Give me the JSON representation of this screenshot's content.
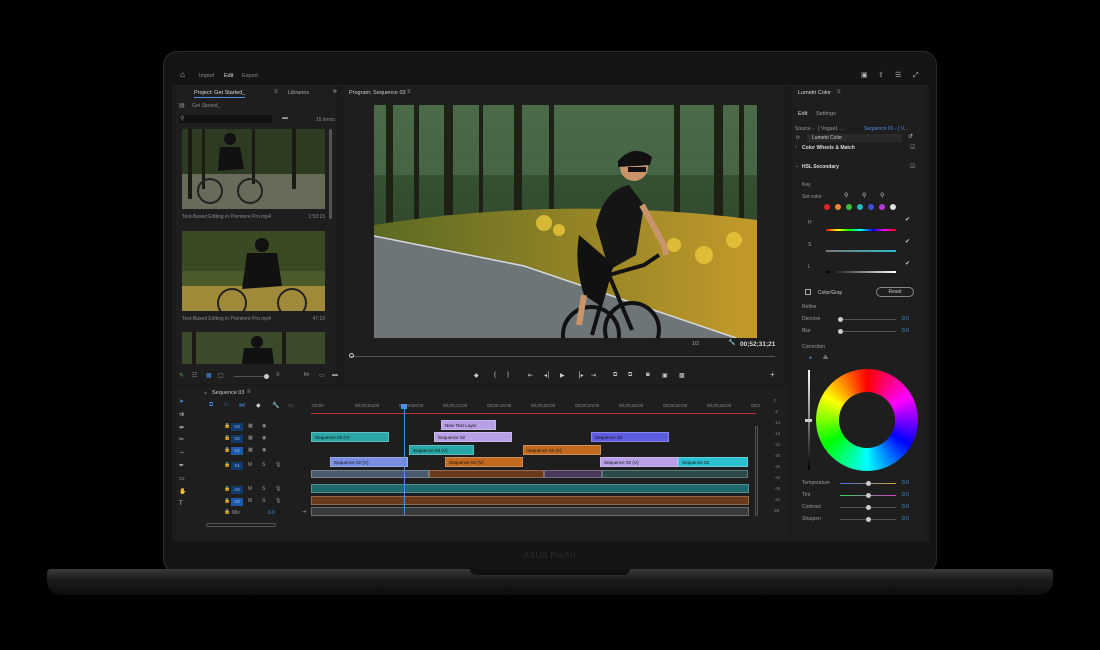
{
  "topbar": {
    "tabs": [
      "Import",
      "Edit",
      "Export"
    ],
    "active": "Edit"
  },
  "project": {
    "title": "Project: Get Started_",
    "libraries": "Libraries",
    "bin": "Get Started_",
    "items_count": "15 items",
    "clips": [
      {
        "label": "Text-Based Editing in Premiere Pro.mp4",
        "duration": "1:53:15"
      },
      {
        "label": "Text-Based Editing in Premiere Pro.mp4",
        "duration": "47:18"
      }
    ]
  },
  "program": {
    "title": "Program: Sequence 03",
    "resolution": "1/2",
    "timecode": "00;52;31;21",
    "playhead_fraction": 0.0
  },
  "lumetri": {
    "title": "Lumetri Color",
    "tabs": [
      "Edit",
      "Settings"
    ],
    "source_label": "Source -",
    "source_value": "( Vogue1 ... ",
    "source_seq": "Sequence 01 - ( V...",
    "fx_label": "fx",
    "effect": "Lumetri Color",
    "section_wheels": "Color Wheels & Match",
    "section_hsl": "HSL Secondary",
    "key_label": "Key",
    "set_color": "Set color",
    "h": "H",
    "s": "S",
    "l": "L",
    "color_gray": "Color/Gray",
    "reset": "Reset",
    "refine": "Refine",
    "denoise": {
      "label": "Denoise",
      "value": "0.0"
    },
    "blur": {
      "label": "Blur",
      "value": "0.0"
    },
    "correction": "Correction",
    "temperature": {
      "label": "Temperature",
      "value": "0.0"
    },
    "tint": {
      "label": "Tint",
      "value": "0.0"
    },
    "contrast": {
      "label": "Contrast",
      "value": "0.0"
    },
    "sharpen": {
      "label": "Sharpen",
      "value": "0.0"
    },
    "swatches": [
      "#d7262b",
      "#e8882a",
      "#3cbf3a",
      "#2bb6c0",
      "#3b4ee0",
      "#b73bd6",
      "#e0e0e0"
    ]
  },
  "timeline": {
    "title": "Sequence 03",
    "ruler": [
      ":00;00",
      "00;00;04;00",
      "00;00;08;00",
      "00;00;12;00",
      "00;00;16;00",
      "00;00;20;00",
      "00;00;24;00",
      "00;00;28;00",
      "00;00;32;00",
      "00;00;36;00",
      "00;0"
    ],
    "tracks": [
      "V3",
      "V2",
      "V1",
      "A1",
      "A2",
      "A3"
    ],
    "mix": "Mix",
    "mix_value": "0.0",
    "track_letters": {
      "m": "M",
      "s": "S"
    },
    "clips": [
      {
        "label": "New Text Layer",
        "color": "#b9a0e6"
      },
      {
        "label": "Sequence 03 (V)",
        "color": "#2aa6a6"
      },
      {
        "label": "Sequence 02",
        "color": "#b9a0e6"
      },
      {
        "label": "Sequence 03",
        "color": "#5e5ce0"
      },
      {
        "label": "Sequence 03 (V)",
        "color": "#2aa6a6"
      },
      {
        "label": "Sequence 03 (V)",
        "color": "#c0691f"
      },
      {
        "label": "Sequence 02 (V)",
        "color": "#7b8de0"
      },
      {
        "label": "Sequence 02 (V)",
        "color": "#c0691f"
      },
      {
        "label": "Sequence 02 (V)",
        "color": "#b9a0e6"
      },
      {
        "label": "Sequence 02",
        "color": "#2ac0d0"
      }
    ],
    "meter": [
      "0",
      "-6",
      "-12",
      "-18",
      "-24",
      "-30",
      "-36",
      "-42",
      "-48",
      "-54",
      "dB"
    ]
  },
  "brand": "ASUS ProArt"
}
